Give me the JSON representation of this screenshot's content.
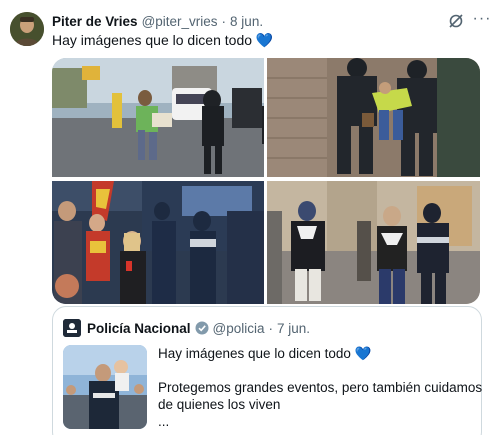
{
  "tweet": {
    "author_name": "Piter de Vries",
    "handle": "@piter_vries",
    "separator": "·",
    "date": "8 jun.",
    "text": "Hay imágenes que lo dicen todo",
    "heart": "💙",
    "more": "···"
  },
  "quoted": {
    "author_name": "Policía Nacional",
    "handle": "@policia",
    "separator": "·",
    "date": "7 jun.",
    "line1": "Hay imágenes que lo dicen todo",
    "heart": "💙",
    "line2": "Protegemos grandes eventos, pero también cuidamos",
    "line3": "de quienes los viven",
    "line4": "..."
  },
  "colors": {
    "accent": "#1d9bf0",
    "verified": "#1d9bf0",
    "secondary_text": "#536471"
  }
}
